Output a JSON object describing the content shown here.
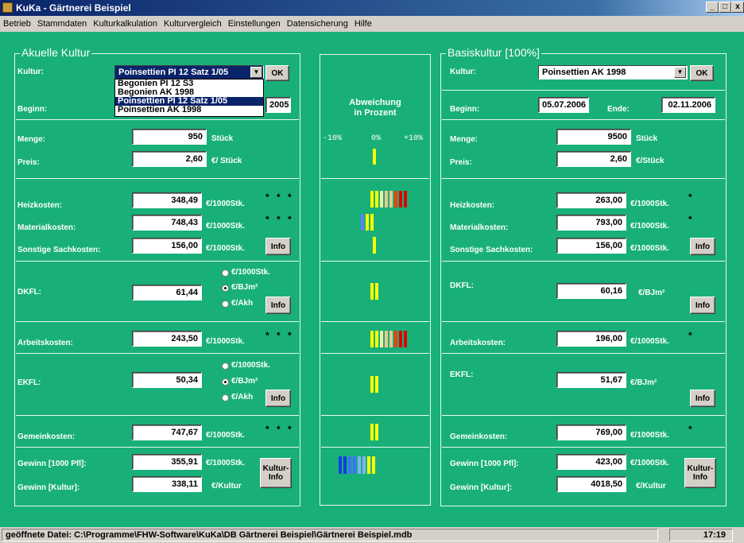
{
  "window": {
    "title": "KuKa - Gärtnerei Beispiel",
    "min": "_",
    "max": "□",
    "close": "x"
  },
  "menu": [
    "Betrieb",
    "Stammdaten",
    "Kulturkalkulation",
    "Kulturvergleich",
    "Einstellungen",
    "Datensicherung",
    "Hilfe"
  ],
  "left": {
    "title": "Akuelle Kultur",
    "kultur_label": "Kultur:",
    "kultur_value": "Poinsettien PI 12 Satz 1/05",
    "ok": "OK",
    "dropdown": [
      "Begonien PI 12 S3",
      "Begonien AK 1998",
      "Poinsettien PI 12 Satz 1/05",
      "Poinsettien AK 1998"
    ],
    "beginn_label": "Beginn:",
    "ende_value": "2005",
    "menge_label": "Menge:",
    "menge_value": "950",
    "menge_unit": "Stück",
    "preis_label": "Preis:",
    "preis_value": "2,60",
    "preis_unit": "€/ Stück",
    "heiz_label": "Heizkosten:",
    "heiz_value": "348,49",
    "heiz_unit": "€/1000Stk.",
    "heiz_stars": "* * *",
    "mat_label": "Materialkosten:",
    "mat_value": "748,43",
    "mat_unit": "€/1000Stk.",
    "mat_stars": "* * *",
    "sonst_label": "Sonstige Sachkosten:",
    "sonst_value": "156,00",
    "sonst_unit": "€/1000Stk.",
    "info": "Info",
    "dkfl_label": "DKFL:",
    "dkfl_value": "61,44",
    "dkfl_opt1": "€/1000Stk.",
    "dkfl_opt2": "€/BJm²",
    "dkfl_opt3": "€/Akh",
    "arb_label": "Arbeitskosten:",
    "arb_value": "243,50",
    "arb_unit": "€/1000Stk.",
    "arb_stars": "* * *",
    "ekfl_label": "EKFL:",
    "ekfl_value": "50,34",
    "ekfl_opt1": "€/1000Stk.",
    "ekfl_opt2": "€/BJm²",
    "ekfl_opt3": "€/Akh",
    "gem_label": "Gemeinkosten:",
    "gem_value": "747,67",
    "gem_unit": "€/1000Stk.",
    "gem_stars": "* * *",
    "gew1_label": "Gewinn [1000 Pfl]:",
    "gew1_value": "355,91",
    "gew1_unit": "€/1000Stk.",
    "gew2_label": "Gewinn [Kultur]:",
    "gew2_value": "338,11",
    "gew2_unit": "€/Kultur",
    "kultur_info": "Kultur-\nInfo"
  },
  "center": {
    "header_l1": "Abweichung",
    "header_l2": "in Prozent",
    "scale_minus": "-10%",
    "scale_zero": "0%",
    "scale_plus": "+10%"
  },
  "right": {
    "title": "Basiskultur [100%]",
    "kultur_label": "Kultur:",
    "kultur_value": "Poinsettien AK 1998",
    "ok": "OK",
    "beginn_label": "Beginn:",
    "beginn_value": "05.07.2006",
    "ende_label": "Ende:",
    "ende_value": "02.11.2006",
    "menge_label": "Menge:",
    "menge_value": "9500",
    "menge_unit": "Stück",
    "preis_label": "Preis:",
    "preis_value": "2,60",
    "preis_unit": "€/Stück",
    "heiz_label": "Heizkosten:",
    "heiz_value": "263,00",
    "heiz_unit": "€/1000Stk.",
    "heiz_stars": "*",
    "mat_label": "Materialkosten:",
    "mat_value": "793,00",
    "mat_unit": "€/1000Stk.",
    "mat_stars": "*",
    "sonst_label": "Sonstige Sachkosten:",
    "sonst_value": "156,00",
    "sonst_unit": "€/1000Stk.",
    "info": "Info",
    "dkfl_label": "DKFL:",
    "dkfl_value": "60,16",
    "dkfl_unit": "€/BJm²",
    "arb_label": "Arbeitskosten:",
    "arb_value": "196,00",
    "arb_unit": "€/1000Stk.",
    "arb_stars": "*",
    "ekfl_label": "EKFL:",
    "ekfl_value": "51,67",
    "ekfl_unit": "€/BJm²",
    "gem_label": "Gemeinkosten:",
    "gem_value": "769,00",
    "gem_unit": "€/1000Stk.",
    "gem_stars": "*",
    "gew1_label": "Gewinn [1000 Pfl]:",
    "gew1_value": "423,00",
    "gew1_unit": "€/1000Stk.",
    "gew2_label": "Gewinn [Kultur]:",
    "gew2_value": "4018,50",
    "gew2_unit": "€/Kultur",
    "kultur_info": "Kultur-\nInfo"
  },
  "status": {
    "path": "geöffnete Datei: C:\\Programme\\FHW-Software\\KuKa\\DB Gärtnerei Beispiel\\Gärtnerei Beispiel.mdb",
    "time": "17:19"
  },
  "colors": {
    "background": "#18b078",
    "yellow": "#ffff00",
    "tan": "#e8c890",
    "orange": "#f0a000",
    "red": "#e00000",
    "blue": "#1040e0",
    "lightblue": "#60a0ff"
  }
}
